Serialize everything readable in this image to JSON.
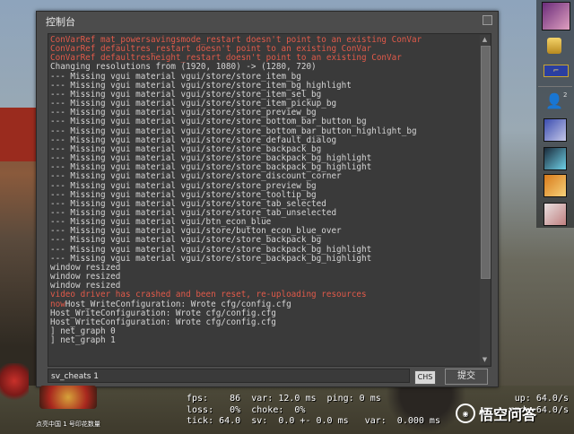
{
  "console": {
    "title": "控制台",
    "lines": [
      {
        "text": "ConVarRef mat_powersavingsmode_restart doesn't point to an existing ConVar",
        "error": true
      },
      {
        "text": "ConVarRef defaultres_restart doesn't point to an existing ConVar",
        "error": true
      },
      {
        "text": "ConVarRef defaultresheight_restart doesn't point to an existing ConVar",
        "error": true
      },
      {
        "text": "Changing resolutions from (1920, 1080) -> (1280, 720)",
        "error": false
      },
      {
        "text": "--- Missing vgui material vgui/store/store_item_bg",
        "error": false
      },
      {
        "text": "--- Missing vgui material vgui/store/store_item_bg_highlight",
        "error": false
      },
      {
        "text": "--- Missing vgui material vgui/store/store_item_sel_bg",
        "error": false
      },
      {
        "text": "--- Missing vgui material vgui/store/store_item_pickup_bg",
        "error": false
      },
      {
        "text": "--- Missing vgui material vgui/store/store_preview_bg",
        "error": false
      },
      {
        "text": "--- Missing vgui material vgui/store/store_bottom_bar_button_bg",
        "error": false
      },
      {
        "text": "--- Missing vgui material vgui/store/store_bottom_bar_button_highlight_bg",
        "error": false
      },
      {
        "text": "--- Missing vgui material vgui/store/store_default_dialog",
        "error": false
      },
      {
        "text": "--- Missing vgui material vgui/store/store_backpack_bg",
        "error": false
      },
      {
        "text": "--- Missing vgui material vgui/store/store_backpack_bg_highlight",
        "error": false
      },
      {
        "text": "--- Missing vgui material vgui/store/store_backpack_bg_highlight",
        "error": false
      },
      {
        "text": "--- Missing vgui material vgui/store/store_discount_corner",
        "error": false
      },
      {
        "text": "--- Missing vgui material vgui/store/store_preview_bg",
        "error": false
      },
      {
        "text": "--- Missing vgui material vgui/store/store_tooltip_bg",
        "error": false
      },
      {
        "text": "--- Missing vgui material vgui/store/store_tab_selected",
        "error": false
      },
      {
        "text": "--- Missing vgui material vgui/store/store_tab_unselected",
        "error": false
      },
      {
        "text": "--- Missing vgui material vgui/btn_econ_blue",
        "error": false
      },
      {
        "text": "--- Missing vgui material vgui/store/button_econ_blue_over",
        "error": false
      },
      {
        "text": "--- Missing vgui material vgui/store/store_backpack_bg",
        "error": false
      },
      {
        "text": "--- Missing vgui material vgui/store/store_backpack_bg_highlight",
        "error": false
      },
      {
        "text": "--- Missing vgui material vgui/store/store_backpack_bg_highlight",
        "error": false
      },
      {
        "text": "window resized",
        "error": false
      },
      {
        "text": "window resized",
        "error": false
      },
      {
        "text": "window resized",
        "error": false
      },
      {
        "text": "video driver has crashed and been reset, re-uploading resources",
        "error": true
      },
      {
        "text": "Host_WriteConfiguration: Wrote cfg/config.cfg",
        "error": false,
        "prefix": "now"
      },
      {
        "text": "Host_WriteConfiguration: Wrote cfg/config.cfg",
        "error": false
      },
      {
        "text": "Host_WriteConfiguration: Wrote cfg/config.cfg",
        "error": false
      },
      {
        "text": "] net_graph 0",
        "error": false
      },
      {
        "text": "] net_graph 1",
        "error": false
      }
    ],
    "input_value": "sv_cheats 1",
    "ime_label": "CHS",
    "submit_label": "提交"
  },
  "netgraph": {
    "line1": "fps:    86  var: 12.0 ms  ping: 0 ms",
    "line2": "loss:   0%  choke:  0%",
    "line3": "tick: 64.0  sv:  0.0 +- 0.0 ms   var:  0.000 ms",
    "right1": "up: 64.0/s",
    "right2": "cmd: 64.0/s"
  },
  "hud": {
    "player_name": "点亮中国 1 号印花数量"
  },
  "sidebar": {
    "friends_count": "2"
  },
  "watermark": {
    "text": "悟空问答"
  },
  "colors": {
    "error_text": "#e15a4a",
    "log_text": "#d6d6d6",
    "console_bg": "#4c4c4c"
  }
}
